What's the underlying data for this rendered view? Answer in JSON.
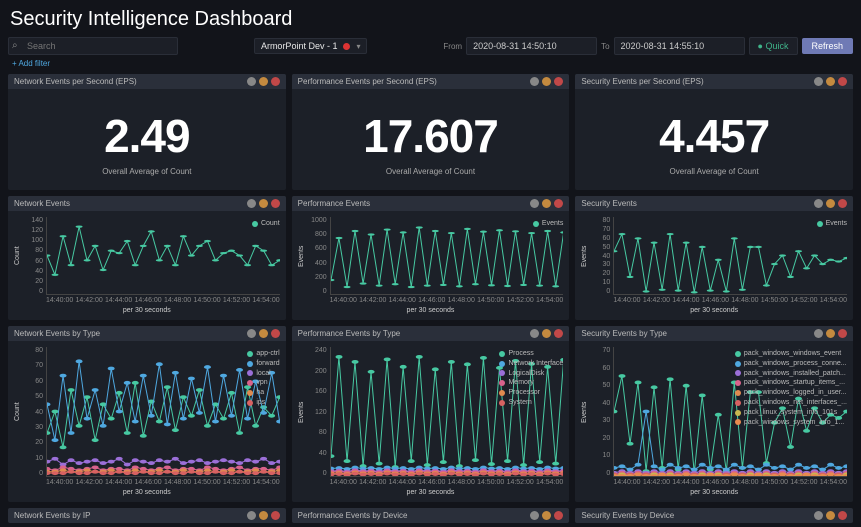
{
  "page": {
    "title": "Security Intelligence Dashboard",
    "add_filter": "+ Add filter"
  },
  "search": {
    "placeholder": "Search"
  },
  "selector": {
    "label": "ArmorPoint Dev - 1"
  },
  "time": {
    "from_lbl": "From",
    "to_lbl": "To",
    "from": "2020-08-31 14:50:10",
    "to": "2020-08-31 14:55:10"
  },
  "buttons": {
    "quick": "Quick",
    "refresh": "Refresh"
  },
  "avg_sub": "Overall Average of Count",
  "xlbl": "per 30 seconds",
  "panels": {
    "net_eps": {
      "title": "Network Events per Second (EPS)",
      "value": "2.49"
    },
    "perf_eps": {
      "title": "Performance Events per Second (EPS)",
      "value": "17.607"
    },
    "sec_eps": {
      "title": "Security Events per Second (EPS)",
      "value": "4.457"
    },
    "net": {
      "title": "Network Events",
      "legend": "Count",
      "ylbl": "Count"
    },
    "perf": {
      "title": "Performance Events",
      "legend": "Events",
      "ylbl": "Events"
    },
    "sec": {
      "title": "Security Events",
      "legend": "Events",
      "ylbl": "Events"
    },
    "net_type": {
      "title": "Network Events by Type",
      "ylbl": "Count",
      "legend": [
        "app-ctrl",
        "forward",
        "local",
        "vpn",
        "ha",
        "ips"
      ]
    },
    "perf_type": {
      "title": "Performance Events by Type",
      "ylbl": "Events",
      "legend": [
        "Process",
        "Network Interface",
        "LogicalDisk",
        "Memory",
        "Processor",
        "System"
      ]
    },
    "sec_type": {
      "title": "Security Events by Type",
      "ylbl": "Events",
      "legend": [
        "pack_windows_windows_event",
        "pack_windows_process_conne...",
        "pack_windows_installed_patch...",
        "pack_windows_startup_items_...",
        "pack_windows_logged_in_user...",
        "pack_windows_net_interfaces_...",
        "pack_linux_system_info_101s",
        "pack_windows_system_info_1..."
      ]
    },
    "net_ip": {
      "title": "Network Events by IP"
    },
    "perf_dev": {
      "title": "Performance Events by Device"
    },
    "sec_dev": {
      "title": "Security Events by Device"
    }
  },
  "chart_data": {
    "xticks": [
      "14:40:00",
      "14:42:00",
      "14:44:00",
      "14:46:00",
      "14:48:00",
      "14:50:00",
      "14:52:00",
      "14:54:00"
    ],
    "net": {
      "type": "line",
      "ylim": [
        0,
        160
      ],
      "yticks": [
        0,
        20,
        40,
        60,
        80,
        100,
        120,
        140
      ],
      "series": [
        {
          "name": "Count",
          "color": "#47c9a2",
          "values": [
            80,
            40,
            120,
            60,
            140,
            70,
            100,
            50,
            90,
            85,
            110,
            60,
            100,
            130,
            70,
            100,
            60,
            120,
            80,
            100,
            110,
            70,
            85,
            90,
            80,
            60,
            100,
            90,
            60,
            70
          ]
        }
      ]
    },
    "perf": {
      "type": "line",
      "ylim": [
        0,
        1100
      ],
      "yticks": [
        0,
        200,
        400,
        600,
        800,
        1000
      ],
      "series": [
        {
          "name": "Events",
          "color": "#47c9a2",
          "values": [
            200,
            800,
            100,
            900,
            150,
            850,
            120,
            920,
            140,
            880,
            100,
            950,
            120,
            900,
            130,
            870,
            110,
            930,
            140,
            890,
            125,
            910,
            115,
            895,
            130,
            870,
            120,
            900,
            110,
            880
          ]
        }
      ]
    },
    "sec": {
      "type": "line",
      "ylim": [
        0,
        90
      ],
      "yticks": [
        0,
        10,
        20,
        30,
        40,
        50,
        60,
        70,
        80
      ],
      "series": [
        {
          "name": "Events",
          "color": "#47c9a2",
          "values": [
            50,
            70,
            20,
            65,
            3,
            60,
            5,
            70,
            4,
            60,
            2,
            55,
            4,
            40,
            3,
            65,
            5,
            55,
            55,
            10,
            35,
            45,
            20,
            50,
            30,
            45,
            35,
            40,
            38,
            42
          ]
        }
      ]
    },
    "net_type": {
      "type": "line",
      "ylim": [
        0,
        90
      ],
      "yticks": [
        0,
        10,
        20,
        30,
        40,
        50,
        60,
        70,
        80
      ],
      "series": [
        {
          "name": "app-ctrl",
          "color": "#47c9a2",
          "values": [
            30,
            45,
            20,
            60,
            35,
            55,
            25,
            50,
            40,
            58,
            30,
            65,
            28,
            52,
            38,
            62,
            32,
            55,
            42,
            60,
            35,
            50,
            40,
            58,
            30,
            62,
            35,
            48,
            42,
            55
          ]
        },
        {
          "name": "forward",
          "color": "#4fa8e0",
          "values": [
            50,
            25,
            70,
            30,
            80,
            40,
            60,
            35,
            75,
            45,
            65,
            38,
            70,
            42,
            78,
            36,
            72,
            40,
            68,
            44,
            76,
            38,
            70,
            42,
            74,
            40,
            66,
            44,
            72,
            38
          ]
        },
        {
          "name": "local",
          "color": "#9b6fd8",
          "values": [
            10,
            12,
            8,
            11,
            9,
            10,
            11,
            9,
            10,
            12,
            8,
            11,
            10,
            9,
            11,
            10,
            12,
            9,
            10,
            11,
            9,
            10,
            11,
            10,
            9,
            11,
            10,
            12,
            9,
            10
          ]
        },
        {
          "name": "vpn",
          "color": "#d8628c",
          "values": [
            5,
            4,
            6,
            5,
            4,
            5,
            6,
            4,
            5,
            5,
            4,
            6,
            5,
            4,
            5,
            6,
            4,
            5,
            5,
            4,
            6,
            5,
            4,
            5,
            6,
            4,
            5,
            5,
            4,
            6
          ]
        },
        {
          "name": "ha",
          "color": "#e08a4f",
          "values": [
            3,
            3,
            4,
            3,
            3,
            4,
            3,
            3,
            4,
            3,
            3,
            4,
            3,
            3,
            4,
            3,
            3,
            4,
            3,
            3,
            4,
            3,
            3,
            4,
            3,
            3,
            4,
            3,
            3,
            4
          ]
        },
        {
          "name": "ips",
          "color": "#d86262",
          "values": [
            2,
            2,
            2,
            3,
            2,
            2,
            3,
            2,
            2,
            3,
            2,
            2,
            3,
            2,
            2,
            3,
            2,
            2,
            3,
            2,
            2,
            3,
            2,
            2,
            3,
            2,
            2,
            3,
            2,
            2
          ]
        }
      ]
    },
    "perf_type": {
      "type": "line",
      "ylim": [
        0,
        260
      ],
      "yticks": [
        0,
        40,
        80,
        120,
        160,
        200,
        240
      ],
      "series": [
        {
          "name": "Process",
          "color": "#47c9a2",
          "values": [
            40,
            240,
            30,
            230,
            20,
            210,
            25,
            235,
            18,
            220,
            30,
            240,
            22,
            215,
            28,
            230,
            20,
            225,
            32,
            238,
            24,
            218,
            30,
            232,
            22,
            226,
            28,
            220,
            25,
            234
          ]
        },
        {
          "name": "Network Interface",
          "color": "#4fa8e0",
          "values": [
            15,
            16,
            14,
            17,
            15,
            16,
            14,
            17,
            15,
            16,
            14,
            17,
            15,
            16,
            14,
            17,
            15,
            16,
            14,
            17,
            15,
            16,
            14,
            17,
            15,
            16,
            14,
            17,
            15,
            16
          ]
        },
        {
          "name": "LogicalDisk",
          "color": "#9b6fd8",
          "values": [
            10,
            11,
            9,
            12,
            10,
            11,
            9,
            12,
            10,
            11,
            9,
            12,
            10,
            11,
            9,
            12,
            10,
            11,
            9,
            12,
            10,
            11,
            9,
            12,
            10,
            11,
            9,
            12,
            10,
            11
          ]
        },
        {
          "name": "Memory",
          "color": "#d8628c",
          "values": [
            8,
            9,
            7,
            10,
            8,
            9,
            7,
            10,
            8,
            9,
            7,
            10,
            8,
            9,
            7,
            10,
            8,
            9,
            7,
            10,
            8,
            9,
            7,
            10,
            8,
            9,
            7,
            10,
            8,
            9
          ]
        },
        {
          "name": "Processor",
          "color": "#e08a4f",
          "values": [
            5,
            6,
            4,
            7,
            5,
            6,
            4,
            7,
            5,
            6,
            4,
            7,
            5,
            6,
            4,
            7,
            5,
            6,
            4,
            7,
            5,
            6,
            4,
            7,
            5,
            6,
            4,
            7,
            5,
            6
          ]
        },
        {
          "name": "System",
          "color": "#d86262",
          "values": [
            3,
            4,
            2,
            5,
            3,
            4,
            2,
            5,
            3,
            4,
            2,
            5,
            3,
            4,
            2,
            5,
            3,
            4,
            2,
            5,
            3,
            4,
            2,
            5,
            3,
            4,
            2,
            5,
            3,
            4
          ]
        }
      ]
    },
    "sec_type": {
      "type": "line",
      "ylim": [
        0,
        80
      ],
      "yticks": [
        0,
        10,
        20,
        30,
        40,
        50,
        60,
        70
      ],
      "series": [
        {
          "name": "pack_windows_windows_event",
          "color": "#47c9a2",
          "values": [
            40,
            62,
            20,
            58,
            3,
            55,
            5,
            60,
            4,
            56,
            2,
            50,
            4,
            38,
            3,
            58,
            5,
            52,
            52,
            8,
            33,
            42,
            18,
            48,
            28,
            42,
            33,
            38,
            36,
            40
          ]
        },
        {
          "name": "pack_windows_process_conne",
          "color": "#4fa8e0",
          "values": [
            5,
            6,
            4,
            7,
            40,
            6,
            4,
            7,
            5,
            6,
            4,
            7,
            5,
            6,
            4,
            7,
            5,
            6,
            4,
            7,
            5,
            6,
            4,
            7,
            5,
            6,
            4,
            7,
            5,
            6
          ]
        },
        {
          "name": "pack_windows_installed_patch",
          "color": "#9b6fd8",
          "values": [
            2,
            3,
            2,
            3,
            2,
            3,
            2,
            3,
            2,
            3,
            2,
            3,
            2,
            3,
            2,
            3,
            2,
            3,
            2,
            3,
            2,
            3,
            2,
            3,
            2,
            3,
            2,
            3,
            2,
            3
          ]
        },
        {
          "name": "pack_windows_startup_items",
          "color": "#d8628c",
          "values": [
            1,
            2,
            1,
            2,
            1,
            2,
            1,
            2,
            1,
            2,
            1,
            2,
            1,
            2,
            1,
            2,
            1,
            2,
            1,
            2,
            1,
            2,
            1,
            2,
            1,
            2,
            1,
            2,
            1,
            2
          ]
        },
        {
          "name": "pack_windows_logged_in_user",
          "color": "#e08a4f",
          "values": [
            1,
            1,
            1,
            1,
            1,
            1,
            1,
            1,
            1,
            1,
            1,
            1,
            1,
            1,
            1,
            1,
            1,
            1,
            1,
            1,
            1,
            1,
            1,
            1,
            1,
            1,
            1,
            1,
            1,
            1
          ]
        },
        {
          "name": "pack_windows_net_interfaces",
          "color": "#d86262",
          "values": [
            1,
            1,
            1,
            1,
            1,
            1,
            1,
            1,
            1,
            1,
            1,
            1,
            1,
            1,
            1,
            1,
            1,
            1,
            1,
            1,
            1,
            1,
            1,
            1,
            1,
            1,
            1,
            1,
            1,
            1
          ]
        },
        {
          "name": "pack_linux_system_info_101s",
          "color": "#c9b54f",
          "values": [
            0,
            1,
            0,
            1,
            0,
            1,
            0,
            1,
            0,
            1,
            0,
            1,
            0,
            1,
            0,
            1,
            0,
            1,
            0,
            1,
            0,
            1,
            0,
            1,
            0,
            1,
            0,
            1,
            0,
            1
          ]
        },
        {
          "name": "pack_windows_system_info_1",
          "color": "#e88a4f",
          "values": [
            0,
            0,
            0,
            1,
            0,
            0,
            1,
            0,
            0,
            1,
            0,
            0,
            1,
            0,
            0,
            1,
            0,
            0,
            1,
            0,
            0,
            1,
            0,
            0,
            1,
            0,
            0,
            1,
            0,
            0
          ]
        }
      ]
    }
  }
}
